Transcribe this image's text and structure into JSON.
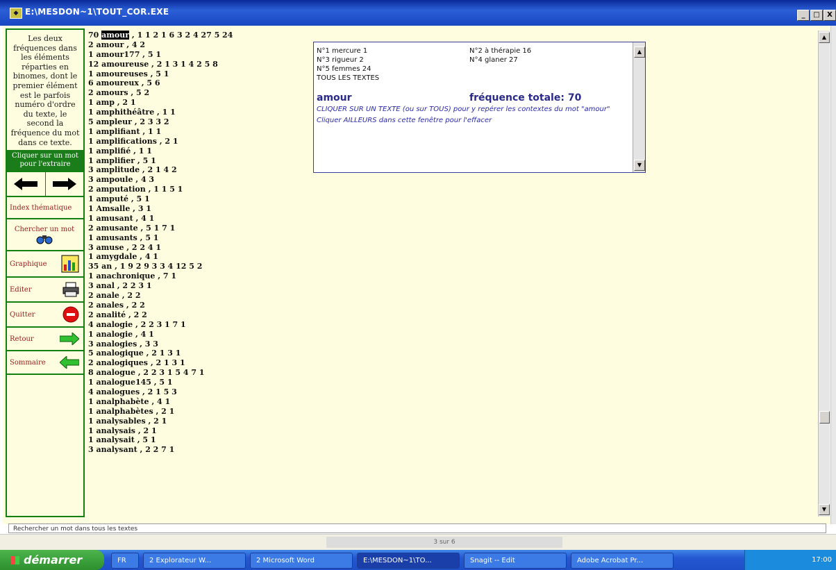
{
  "window": {
    "title": "E:\\MESDON~1\\TOUT_COR.EXE",
    "buttons": {
      "minimize": "_",
      "maximize": "□",
      "close": "X"
    }
  },
  "left_panel": {
    "explanation": "Les deux fréquences dans les éléments réparties en binomes, dont le premier élément est le parfois numéro d'ordre du texte, le second la fréquence du mot dans ce texte.",
    "click_hint": "Cliquer sur un mot pour l'extraire",
    "buttons": [
      {
        "label": "Index thématique",
        "icon": ""
      },
      {
        "label": "Chercher un mot",
        "icon": "binoculars-icon"
      },
      {
        "label": "Graphique",
        "icon": "chart-icon"
      },
      {
        "label": "Editer",
        "icon": "printer-icon"
      },
      {
        "label": "Quitter",
        "icon": "exit-icon"
      },
      {
        "label": "Retour",
        "icon": "arrow-right-icon"
      },
      {
        "label": "Sommaire",
        "icon": "arrow-left-icon"
      }
    ]
  },
  "word_list": {
    "first": {
      "count": "70",
      "word": "amour",
      "rest": ", 1 1 2 1 6 3 2 4 27 5 24"
    },
    "items": [
      "2 amour , 4 2",
      "1 amour177 , 5 1",
      "12 amoureuse , 2 1 3 1 4 2 5 8",
      "1 amoureuses , 5 1",
      "6 amoureux , 5 6",
      "2 amours , 5 2",
      "1 amp , 2 1",
      "1 amphithéâtre , 1 1",
      "5 ampleur , 2 3 3 2",
      "1 amplifiant , 1 1",
      "1 amplifications , 2 1",
      "1 amplifié , 1 1",
      "1 amplifier , 5 1",
      "3 amplitude , 2 1 4 2",
      "3 ampoule , 4 3",
      "2 amputation , 1 1 5 1",
      "1 amputé , 5 1",
      "1 Amsalle , 3 1",
      "1 amusant , 4 1",
      "2 amusante , 5 1 7 1",
      "1 amusants , 5 1",
      "3 amuse , 2 2 4 1",
      "1 amygdale , 4 1",
      "35 an , 1 9 2 9 3 3 4 12 5 2",
      "1 anachronique , 7 1",
      "3 anal , 2 2 3 1",
      "2 anale , 2 2",
      "2 anales , 2 2",
      "2 analité , 2 2",
      "4 analogie , 2 2 3 1 7 1",
      "1 analogie , 4 1",
      "3 analogies , 3 3",
      "5 analogique , 2 1 3 1",
      "2 analogiques , 2 1 3 1",
      "8 analogue , 2 2 3 1 5 4 7 1",
      "1 analogue145 , 5 1",
      "4 analogues , 2 1 5 3",
      "1 analphabète , 4 1",
      "1 analphabètes , 2 1",
      "1 analysables , 2 1",
      "1 analysais , 2 1",
      "1 analysait , 5 1",
      "3 analysant , 2 2 7 1"
    ]
  },
  "info_box": {
    "rows": [
      {
        "c1": "N°1 mercure 1",
        "c2": "N°2 à thérapie 16"
      },
      {
        "c1": "N°3 rigueur 2",
        "c2": "N°4 glaner 27"
      },
      {
        "c1": "N°5 femmes 24",
        "c2": ""
      },
      {
        "c1": "TOUS LES TEXTES",
        "c2": ""
      }
    ],
    "word": "amour",
    "total_label": "fréquence totale: 70",
    "instruction1": "CLIQUER SUR UN TEXTE (ou sur TOUS) pour y repérer les contextes du mot \"amour\"",
    "instruction2": "Cliquer AILLEURS dans cette fenêtre pour l'effacer"
  },
  "status_bar": "Rechercher un mot dans tous les textes",
  "behind_window": {
    "page_indicator": "3 sur 6"
  },
  "taskbar": {
    "start": "démarrer",
    "tasks": [
      {
        "label": "FR"
      },
      {
        "label": "2 Explorateur W...",
        "active": false
      },
      {
        "label": "2 Microsoft Word",
        "active": false
      },
      {
        "label": "E:\\MESDON~1\\TO...",
        "active": true
      },
      {
        "label": "Snagit -- Edit",
        "active": false
      },
      {
        "label": "Adobe Acrobat Pr...",
        "active": false
      }
    ],
    "clock": "17:00"
  },
  "colors": {
    "title_blue": "#1a46c2",
    "panel_green": "#108010",
    "client_bg": "#fffde0",
    "info_blue": "#2a2a8a"
  }
}
